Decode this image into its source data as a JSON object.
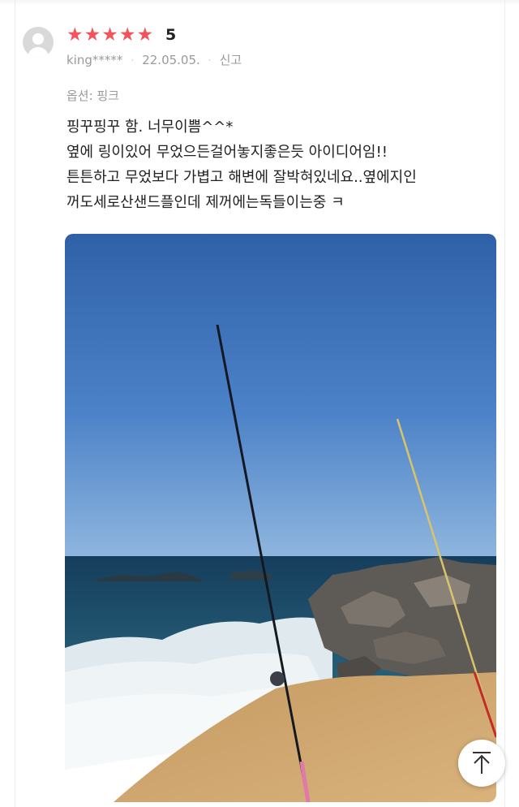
{
  "review": {
    "rating_stars": [
      "★",
      "★",
      "★",
      "★",
      "★"
    ],
    "rating_value": "5",
    "username": "king*****",
    "date": "22.05.05.",
    "report_label": "신고",
    "option_label": "옵션: 핑크",
    "lines": [
      "핑꾸핑꾸 함. 너무이쁨^^*",
      "옆에 링이있어 무었으든걸어놓지좋은듯 아이디어임!!",
      "튼튼하고 무었보다 가볍고 해변에 잘박혀있네요..옆에지인",
      "꺼도세로산샌드플인데 제꺼에는독들이는중 ㅋ"
    ],
    "star_color": "#f2545b"
  },
  "icons": {
    "avatar": "user-placeholder-icon",
    "scroll_top": "arrow-up-icon"
  }
}
